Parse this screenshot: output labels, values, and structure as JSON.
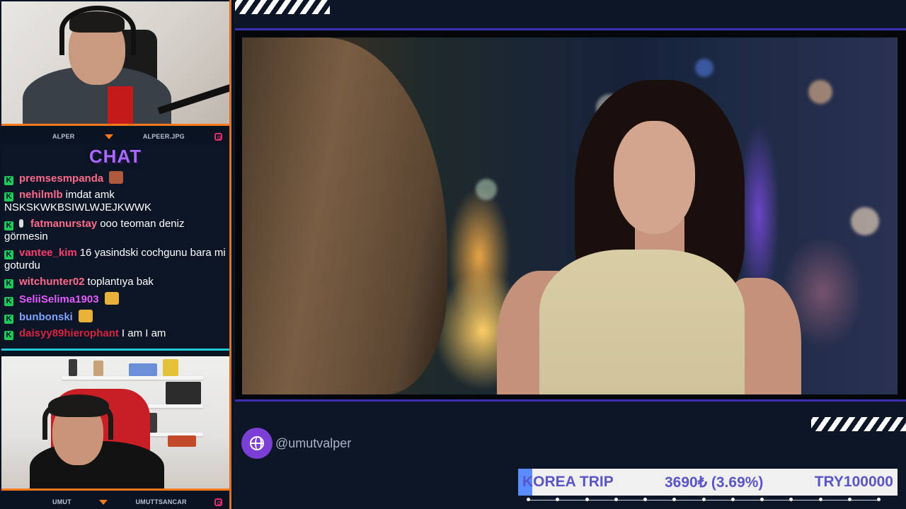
{
  "cams": {
    "top": {
      "label_left": "ALPER",
      "label_right": "ALPEER.JPG"
    },
    "bottom": {
      "label_left": "UMUT",
      "label_right": "UMUTTSANCAR"
    }
  },
  "chat": {
    "title": "CHAT",
    "messages": [
      {
        "user": "premsesmpanda",
        "color": "#ff6b8a",
        "text": ""
      },
      {
        "user": "nehilmlb",
        "color": "#ff6b8a",
        "text": "imdat amk NSKSKWKBSIWLWJEJKWWK"
      },
      {
        "user": "fatmanurstay",
        "color": "#ff6b8a",
        "text": "ooo teoman deniz görmesin"
      },
      {
        "user": "vantee_kim",
        "color": "#ff3d6e",
        "text": "16 yasindski cochgunu bara mi goturdu"
      },
      {
        "user": "witchunter02",
        "color": "#ff6b8a",
        "text": "toplantıya bak"
      },
      {
        "user": "SeliiSelima1903",
        "color": "#e35cff",
        "text": ""
      },
      {
        "user": "bunbonski",
        "color": "#7ea4ff",
        "text": ""
      },
      {
        "user": "daisyy89hierophant",
        "color": "#d6243e",
        "text": "I am I am"
      }
    ]
  },
  "social": {
    "handle": "@umutvalper"
  },
  "goal": {
    "title": "KOREA TRIP",
    "amount": "3690₺ (3.69%)",
    "target": "TRY100000",
    "progress_percent": 3.69
  },
  "colors": {
    "accent_orange": "#ff7a1a",
    "accent_purple": "#a86bff",
    "frame_blue": "#3a2fb0",
    "chat_divider": "#1ec8d8"
  },
  "icons": [
    "instagram-icon",
    "globe-icon",
    "mod-badge-icon"
  ]
}
